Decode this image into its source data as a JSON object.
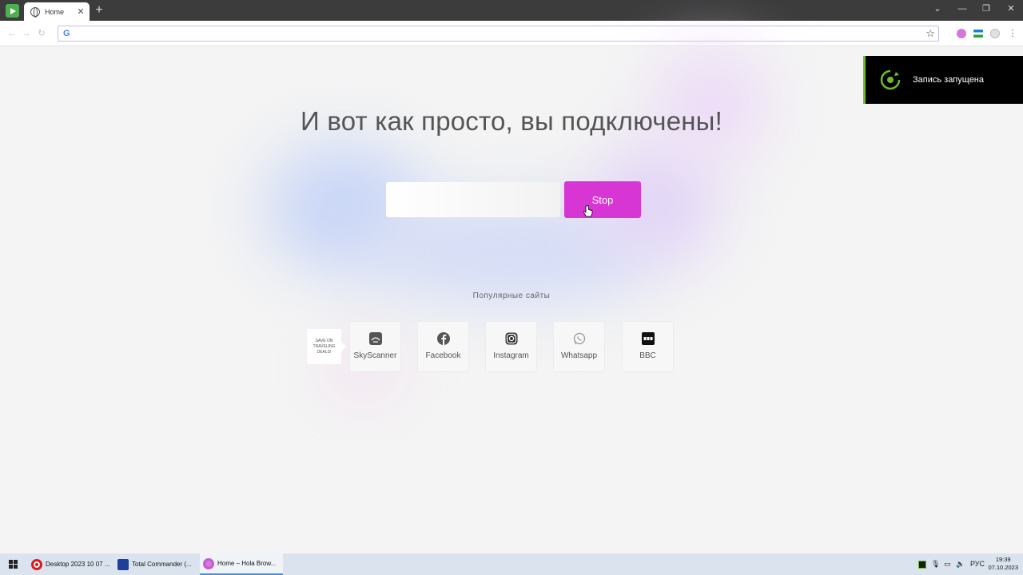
{
  "browser": {
    "tab_title": "Home",
    "tab_close": "✕",
    "new_tab": "+",
    "omnibox_value": "",
    "omnibox_logo": "G",
    "controls": {
      "chevron": "⌄",
      "minimize": "—",
      "restore": "❐",
      "close": "✕"
    },
    "nav": {
      "back": "←",
      "forward": "→",
      "reload": "↻"
    },
    "star": "☆"
  },
  "page": {
    "headline": "И вот как просто, вы подключены!",
    "input_value": "",
    "stop_label": "Stop",
    "popular_label": "Популярные   сайты",
    "ad_text": "SAVE ON TRAVELING DEALS!",
    "sites": [
      {
        "label": "SkyScanner",
        "icon": "skyscanner-icon"
      },
      {
        "label": "Facebook",
        "icon": "facebook-icon"
      },
      {
        "label": "Instagram",
        "icon": "instagram-icon"
      },
      {
        "label": "Whatsapp",
        "icon": "whatsapp-icon"
      },
      {
        "label": "BBC",
        "icon": "bbc-icon"
      }
    ]
  },
  "notification": {
    "text": "Запись запущена",
    "accent": "#6cbd2d"
  },
  "taskbar": {
    "items": [
      {
        "label": "Desktop 2023 10 07 ..."
      },
      {
        "label": "Total Commander (..."
      },
      {
        "label": "Home – Hola Brow..."
      }
    ],
    "lang": "РУС",
    "time": "19:39",
    "date": "07.10.2023"
  },
  "colors": {
    "accent": "#d836d4",
    "background": "#f4f4f4"
  }
}
